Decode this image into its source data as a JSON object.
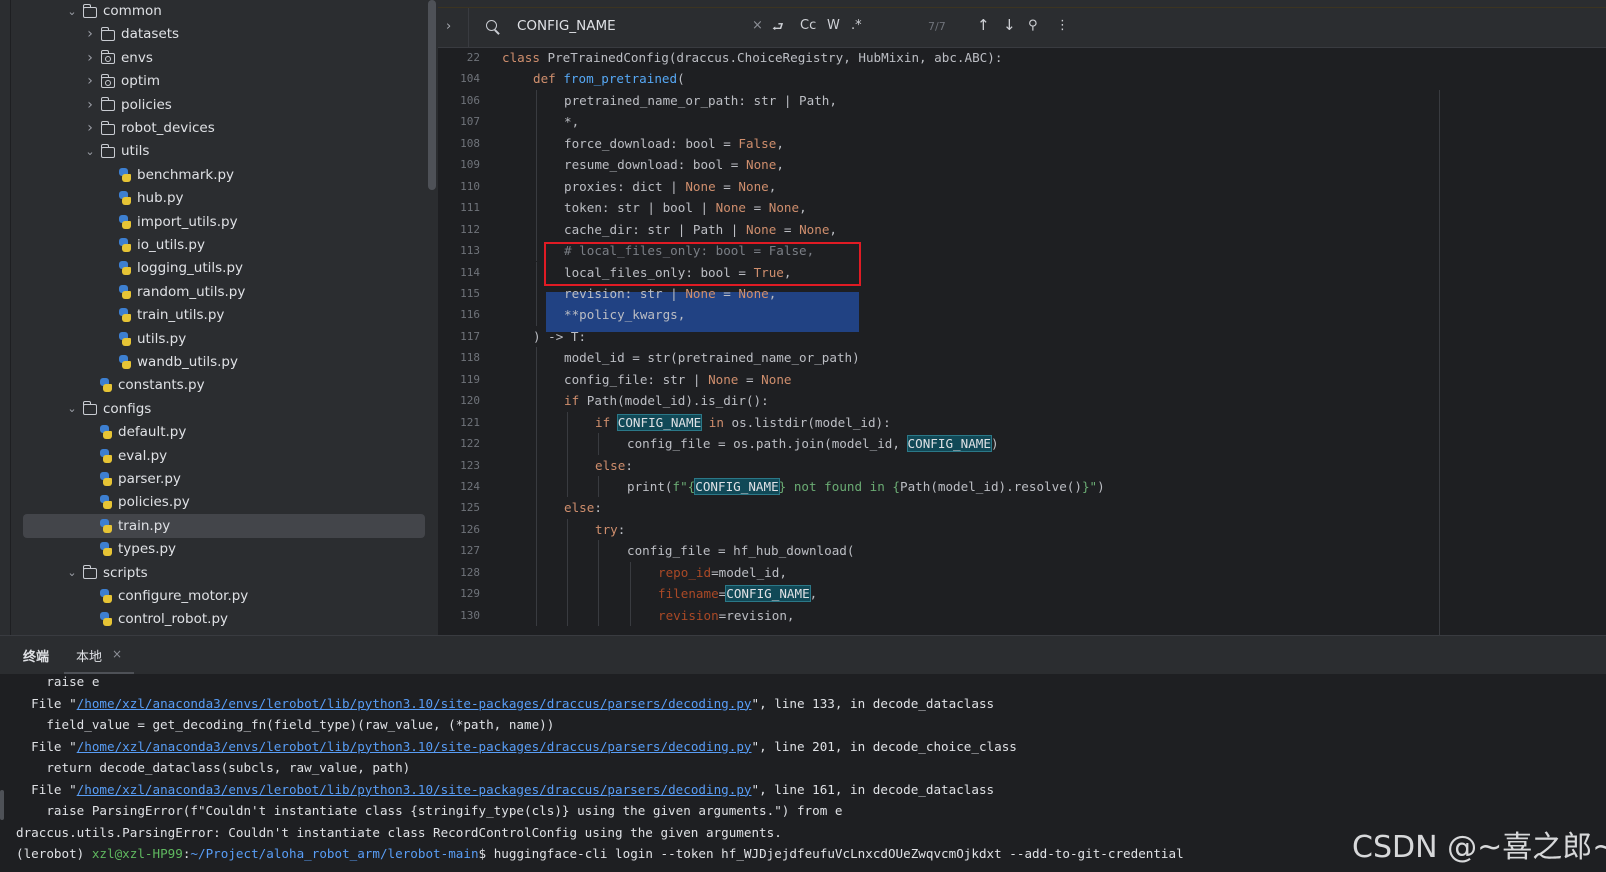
{
  "tree": {
    "items": [
      {
        "label": "common",
        "type": "folder",
        "depth": 0,
        "expanded": true
      },
      {
        "label": "datasets",
        "type": "folder",
        "depth": 1,
        "expanded": false
      },
      {
        "label": "envs",
        "type": "package",
        "depth": 1,
        "expanded": false
      },
      {
        "label": "optim",
        "type": "package",
        "depth": 1,
        "expanded": false
      },
      {
        "label": "policies",
        "type": "folder",
        "depth": 1,
        "expanded": false
      },
      {
        "label": "robot_devices",
        "type": "folder",
        "depth": 1,
        "expanded": false
      },
      {
        "label": "utils",
        "type": "folder",
        "depth": 1,
        "expanded": true
      },
      {
        "label": "benchmark.py",
        "type": "py",
        "depth": 2
      },
      {
        "label": "hub.py",
        "type": "py",
        "depth": 2
      },
      {
        "label": "import_utils.py",
        "type": "py",
        "depth": 2
      },
      {
        "label": "io_utils.py",
        "type": "py",
        "depth": 2
      },
      {
        "label": "logging_utils.py",
        "type": "py",
        "depth": 2
      },
      {
        "label": "random_utils.py",
        "type": "py",
        "depth": 2
      },
      {
        "label": "train_utils.py",
        "type": "py",
        "depth": 2
      },
      {
        "label": "utils.py",
        "type": "py",
        "depth": 2
      },
      {
        "label": "wandb_utils.py",
        "type": "py",
        "depth": 2
      },
      {
        "label": "constants.py",
        "type": "py",
        "depth": 1
      },
      {
        "label": "configs",
        "type": "folder",
        "depth": 0,
        "expanded": true
      },
      {
        "label": "default.py",
        "type": "py",
        "depth": 1
      },
      {
        "label": "eval.py",
        "type": "py",
        "depth": 1
      },
      {
        "label": "parser.py",
        "type": "py",
        "depth": 1
      },
      {
        "label": "policies.py",
        "type": "py",
        "depth": 1
      },
      {
        "label": "train.py",
        "type": "py",
        "depth": 1,
        "selected": true
      },
      {
        "label": "types.py",
        "type": "py",
        "depth": 1
      },
      {
        "label": "scripts",
        "type": "folder",
        "depth": 0,
        "expanded": true
      },
      {
        "label": "configure_motor.py",
        "type": "py",
        "depth": 1
      },
      {
        "label": "control_robot.py",
        "type": "py",
        "depth": 1
      }
    ]
  },
  "findbar": {
    "query": "CONFIG_NAME",
    "clear_icon": "×",
    "replace_icon": "⮐",
    "match_case": "Cc",
    "whole_words": "W",
    "regex": ".*",
    "count": "7/7",
    "prev_icon": "↑",
    "next_icon": "↓",
    "filter_icon": "⚲",
    "more_icon": "⋮",
    "toggle_icon": "›"
  },
  "code": {
    "lines": [
      {
        "n": "22",
        "tokens": [
          [
            "kw",
            "class "
          ],
          [
            "",
            "PreTrainedConfig(draccus.ChoiceRegistry, HubMixin, abc.ABC):"
          ]
        ],
        "indent": 0
      },
      {
        "n": "104",
        "tokens": [
          [
            "kw",
            "def "
          ],
          [
            "fn",
            "from_pretrained"
          ],
          [
            "",
            "("
          ]
        ],
        "indent": 1
      },
      {
        "n": "106",
        "tokens": [
          [
            "",
            "pretrained_name_or_path: str | Path,"
          ]
        ],
        "indent": 2
      },
      {
        "n": "107",
        "tokens": [
          [
            "",
            "*,"
          ]
        ],
        "indent": 2
      },
      {
        "n": "108",
        "tokens": [
          [
            "",
            "force_download: bool = "
          ],
          [
            "kw",
            "False"
          ],
          [
            "",
            ","
          ]
        ],
        "indent": 2
      },
      {
        "n": "109",
        "tokens": [
          [
            "",
            "resume_download: bool = "
          ],
          [
            "kw",
            "None"
          ],
          [
            "",
            ","
          ]
        ],
        "indent": 2
      },
      {
        "n": "110",
        "tokens": [
          [
            "",
            "proxies: dict | "
          ],
          [
            "kw",
            "None"
          ],
          [
            "",
            " = "
          ],
          [
            "kw",
            "None"
          ],
          [
            "",
            ","
          ]
        ],
        "indent": 2
      },
      {
        "n": "111",
        "tokens": [
          [
            "",
            "token: str | bool | "
          ],
          [
            "kw",
            "None"
          ],
          [
            "",
            " = "
          ],
          [
            "kw",
            "None"
          ],
          [
            "",
            ","
          ]
        ],
        "indent": 2
      },
      {
        "n": "112",
        "tokens": [
          [
            "",
            "cache_dir: str | Path | "
          ],
          [
            "kw",
            "None"
          ],
          [
            "",
            " = "
          ],
          [
            "kw",
            "None"
          ],
          [
            "",
            ","
          ]
        ],
        "indent": 2
      },
      {
        "n": "113",
        "tokens": [
          [
            "cm",
            "# local_files_only: bool = False,"
          ]
        ],
        "indent": 2
      },
      {
        "n": "114",
        "tokens": [
          [
            "",
            "local_files_only: bool = "
          ],
          [
            "kw",
            "True"
          ],
          [
            "",
            ","
          ]
        ],
        "indent": 2
      },
      {
        "n": "115",
        "tokens": [
          [
            "",
            "revision: str | "
          ],
          [
            "kw",
            "None"
          ],
          [
            "",
            " = "
          ],
          [
            "kw",
            "None"
          ],
          [
            "",
            ","
          ]
        ],
        "indent": 2
      },
      {
        "n": "116",
        "tokens": [
          [
            "",
            "**policy_kwargs,"
          ]
        ],
        "indent": 2
      },
      {
        "n": "117",
        "tokens": [
          [
            "",
            ") -> T:"
          ]
        ],
        "indent": 1
      },
      {
        "n": "118",
        "tokens": [
          [
            "",
            "model_id = str(pretrained_name_or_path)"
          ]
        ],
        "indent": 2
      },
      {
        "n": "119",
        "tokens": [
          [
            "",
            "config_file: str | "
          ],
          [
            "kw",
            "None"
          ],
          [
            "",
            " = "
          ],
          [
            "kw",
            "None"
          ]
        ],
        "indent": 2
      },
      {
        "n": "120",
        "tokens": [
          [
            "kw",
            "if "
          ],
          [
            "",
            "Path(model_id).is_dir():"
          ]
        ],
        "indent": 2
      },
      {
        "n": "121",
        "tokens": [
          [
            "kw",
            "if "
          ],
          [
            "hl",
            "CONFIG_NAME"
          ],
          [
            "kw",
            " in "
          ],
          [
            "",
            "os.listdir(model_id):"
          ]
        ],
        "indent": 3
      },
      {
        "n": "122",
        "tokens": [
          [
            "",
            "config_file = os.path.join(model_id, "
          ],
          [
            "hl",
            "CONFIG_NAME"
          ],
          [
            "",
            ")"
          ]
        ],
        "indent": 4
      },
      {
        "n": "123",
        "tokens": [
          [
            "kw",
            "else"
          ],
          [
            "",
            ":"
          ]
        ],
        "indent": 3
      },
      {
        "n": "124",
        "tokens": [
          [
            "",
            "print("
          ],
          [
            "fs",
            "f\"{"
          ],
          [
            "hl",
            "CONFIG_NAME"
          ],
          [
            "fs",
            "} not found in {"
          ],
          [
            "",
            "Path(model_id).resolve()"
          ],
          [
            "fs",
            "}\""
          ],
          [
            "",
            ")"
          ]
        ],
        "indent": 4
      },
      {
        "n": "125",
        "tokens": [
          [
            "kw",
            "else"
          ],
          [
            "",
            ":"
          ]
        ],
        "indent": 2
      },
      {
        "n": "126",
        "tokens": [
          [
            "kw",
            "try"
          ],
          [
            "",
            ":"
          ]
        ],
        "indent": 3
      },
      {
        "n": "127",
        "tokens": [
          [
            "",
            "config_file = hf_hub_download("
          ]
        ],
        "indent": 4
      },
      {
        "n": "128",
        "tokens": [
          [
            "pr",
            "repo_id"
          ],
          [
            "",
            "=model_id,"
          ]
        ],
        "indent": 5
      },
      {
        "n": "129",
        "tokens": [
          [
            "pr",
            "filename"
          ],
          [
            "",
            "="
          ],
          [
            "hl",
            "CONFIG_NAME"
          ],
          [
            "",
            ","
          ]
        ],
        "indent": 5
      },
      {
        "n": "130",
        "tokens": [
          [
            "pr",
            "revision"
          ],
          [
            "",
            "=revision,"
          ]
        ],
        "indent": 5
      }
    ]
  },
  "terminal": {
    "tab_title": "终端",
    "tab_local": "本地",
    "tab_close": "×",
    "lines": [
      {
        "parts": [
          [
            "",
            "    raise e"
          ]
        ]
      },
      {
        "parts": [
          [
            "",
            "  File \""
          ],
          [
            "link",
            "/home/xzl/anaconda3/envs/lerobot/lib/python3.10/site-packages/draccus/parsers/decoding.py"
          ],
          [
            "",
            "\", line 133, in decode_dataclass"
          ]
        ]
      },
      {
        "parts": [
          [
            "",
            "    field_value = get_decoding_fn(field_type)(raw_value, (*path, name))"
          ]
        ]
      },
      {
        "parts": [
          [
            "",
            "  File \""
          ],
          [
            "link",
            "/home/xzl/anaconda3/envs/lerobot/lib/python3.10/site-packages/draccus/parsers/decoding.py"
          ],
          [
            "",
            "\", line 201, in decode_choice_class"
          ]
        ]
      },
      {
        "parts": [
          [
            "",
            "    return decode_dataclass(subcls, raw_value, path)"
          ]
        ]
      },
      {
        "parts": [
          [
            "",
            "  File \""
          ],
          [
            "link",
            "/home/xzl/anaconda3/envs/lerobot/lib/python3.10/site-packages/draccus/parsers/decoding.py"
          ],
          [
            "",
            "\", line 161, in decode_dataclass"
          ]
        ]
      },
      {
        "parts": [
          [
            "",
            "    raise ParsingError(f\"Couldn't instantiate class {stringify_type(cls)} using the given arguments.\") from e"
          ]
        ]
      },
      {
        "parts": [
          [
            "",
            "draccus.utils.ParsingError: Couldn't instantiate class RecordControlConfig using the given arguments."
          ]
        ]
      },
      {
        "parts": [
          [
            "",
            "(lerobot) "
          ],
          [
            "user",
            "xzl@xzl-HP99"
          ],
          [
            "",
            ":"
          ],
          [
            "path",
            "~/Project/aloha_robot_arm/lerobot-main"
          ],
          [
            "",
            "$ huggingface-cli login --token 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 --add-to-git-credential"
          ]
        ]
      }
    ]
  },
  "watermark": "CSDN @~喜之郎~",
  "colors": {
    "keyword": "#cf8e6d",
    "function": "#56a8f5",
    "comment": "#7a7e85",
    "param": "#aa4926",
    "search_highlight": "#114957",
    "selection": "#214283",
    "annotation_box": "#e01b24",
    "link": "#589df6"
  }
}
